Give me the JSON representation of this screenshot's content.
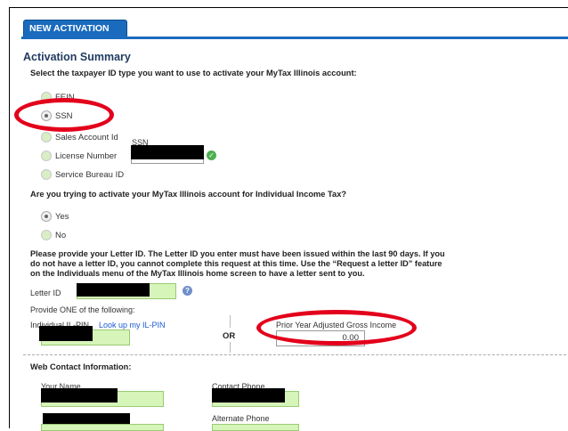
{
  "tab": {
    "label": "NEW ACTIVATION"
  },
  "heading": "Activation Summary",
  "taxpayer_id": {
    "question": "Select the taxpayer ID type you want to use to activate your MyTax Illinois account:",
    "options": [
      "FEIN",
      "SSN",
      "Sales Account Id",
      "License Number",
      "Service Bureau ID"
    ],
    "selected": "SSN",
    "ssn_label": "SSN"
  },
  "individual_income": {
    "question": "Are you trying to activate your MyTax Illinois account for Individual Income Tax?",
    "options": [
      "Yes",
      "No"
    ],
    "selected": "Yes"
  },
  "letter_instructions": "Please provide your Letter ID. The Letter ID you enter must have been issued within the last 90 days. If you do not have a letter ID, you cannot complete this request at this time. Use the “Request a letter ID” feature on the Individuals menu of the MyTax Illinois home screen to have a letter sent to you.",
  "letter_id": {
    "label": "Letter ID"
  },
  "provide_one": "Provide ONE of the following:",
  "il_pin": {
    "label": "Individual IL-PIN",
    "link": "Look up my IL-PIN"
  },
  "or_label": "OR",
  "agi": {
    "label": "Prior Year Adjusted Gross Income",
    "value": "0.00"
  },
  "web_contact": {
    "heading": "Web Contact Information:",
    "your_name": "Your Name",
    "contact_phone": "Contact Phone",
    "alternate_phone": "Alternate Phone"
  },
  "colors": {
    "accent": "#1a6bbd",
    "field_green": "#d6f5b9",
    "annotation_red": "#e3001b"
  }
}
